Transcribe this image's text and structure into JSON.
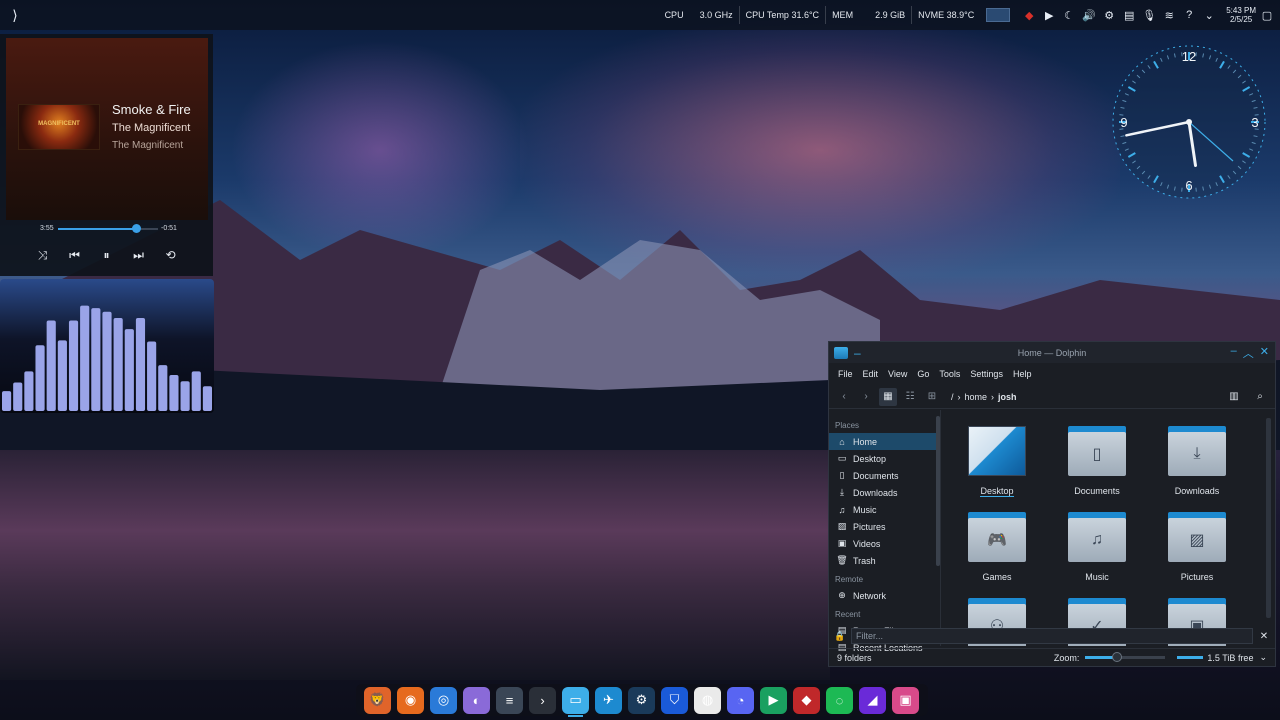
{
  "colors": {
    "accent": "#3daee9",
    "panel": "#0c121e",
    "window_bg": "#1b1e24",
    "selection": "#1d4a6a"
  },
  "top_panel": {
    "launcher_icon": "kde-launcher-icon",
    "sysmon": {
      "cpu_label": "CPU",
      "cpu_freq": "3.0 GHz",
      "cpu_temp": "CPU Temp  31.6°C",
      "mem_label": "MEM",
      "mem_value": "2.9 GiB",
      "nvme": "NVME  38.9°C"
    },
    "tray_icons": [
      "network-graph",
      "ruby-icon",
      "play-icon",
      "moon-icon",
      "volume-icon",
      "steam-icon",
      "clipboard-icon",
      "microphone-icon",
      "wifi-icon",
      "help-icon",
      "chevron-up-icon"
    ],
    "clock": {
      "time": "5:43 PM",
      "date": "2/5/25"
    }
  },
  "media_player": {
    "title": "Smoke & Fire",
    "album": "The Magnificent",
    "artist": "The Magnificent",
    "cover_text": "MAGNIFICENT",
    "elapsed": "3:55",
    "remaining": "-0:51",
    "progress": 0.78,
    "controls": [
      "shuffle",
      "previous",
      "pause",
      "next",
      "repeat"
    ]
  },
  "visualizer": {
    "bars": [
      0.16,
      0.23,
      0.32,
      0.53,
      0.73,
      0.57,
      0.73,
      0.85,
      0.83,
      0.8,
      0.75,
      0.66,
      0.75,
      0.56,
      0.37,
      0.29,
      0.24,
      0.32,
      0.2
    ]
  },
  "analog_clock": {
    "numbers": [
      "12",
      "3",
      "6",
      "9"
    ],
    "time": {
      "hour": 5,
      "minute": 43
    }
  },
  "dolphin": {
    "title": "Home — Dolphin",
    "menu": [
      "File",
      "Edit",
      "View",
      "Go",
      "Tools",
      "Settings",
      "Help"
    ],
    "breadcrumb": [
      "/",
      "home",
      "josh"
    ],
    "places_heading": "Places",
    "places": [
      {
        "label": "Home",
        "icon": "home-icon",
        "selected": true
      },
      {
        "label": "Desktop",
        "icon": "desktop-icon"
      },
      {
        "label": "Documents",
        "icon": "document-icon"
      },
      {
        "label": "Downloads",
        "icon": "download-icon"
      },
      {
        "label": "Music",
        "icon": "music-icon"
      },
      {
        "label": "Pictures",
        "icon": "image-icon"
      },
      {
        "label": "Videos",
        "icon": "video-icon"
      },
      {
        "label": "Trash",
        "icon": "trash-icon"
      }
    ],
    "remote_heading": "Remote",
    "remote": [
      {
        "label": "Network",
        "icon": "network-icon"
      }
    ],
    "recent_heading": "Recent",
    "recent": [
      {
        "label": "Recent Files",
        "icon": "recent-files-icon"
      },
      {
        "label": "Recent Locations",
        "icon": "recent-locations-icon"
      }
    ],
    "folders": [
      {
        "label": "Desktop",
        "icon": "desktop-thumbnail"
      },
      {
        "label": "Documents",
        "icon": "document-icon"
      },
      {
        "label": "Downloads",
        "icon": "download-icon"
      },
      {
        "label": "Games",
        "icon": "gamepad-icon"
      },
      {
        "label": "Music",
        "icon": "music-icon"
      },
      {
        "label": "Pictures",
        "icon": "image-icon"
      },
      {
        "label": "",
        "icon": "people-icon"
      },
      {
        "label": "",
        "icon": "check-icon"
      },
      {
        "label": "",
        "icon": "video-icon"
      }
    ],
    "filter_placeholder": "Filter...",
    "status_count": "9 folders",
    "zoom_label": "Zoom:",
    "zoom_level": 0.4,
    "free_space": "1.5 TiB free"
  },
  "dock": {
    "items": [
      {
        "name": "brave-icon",
        "bg": "#e0642a",
        "glyph": "🦁"
      },
      {
        "name": "firefox-icon",
        "bg": "#e66a1e",
        "glyph": "◉"
      },
      {
        "name": "chromium-icon",
        "bg": "#2a7ad8",
        "glyph": "◎"
      },
      {
        "name": "color-picker-icon",
        "bg": "#8a6ad8",
        "glyph": "◐"
      },
      {
        "name": "system-settings-icon",
        "bg": "#3a4656",
        "glyph": "≡"
      },
      {
        "name": "konsole-icon",
        "bg": "#2a2f38",
        "glyph": "›"
      },
      {
        "name": "dolphin-icon",
        "bg": "#3daee9",
        "glyph": "▭"
      },
      {
        "name": "bottles-icon",
        "bg": "#1d8ad0",
        "glyph": "✈"
      },
      {
        "name": "steam-icon",
        "bg": "#1a3a5a",
        "glyph": "⚙"
      },
      {
        "name": "bitwarden-icon",
        "bg": "#1a5ad8",
        "glyph": "⛉"
      },
      {
        "name": "lutris-icon",
        "bg": "#eaeaea",
        "glyph": "◍"
      },
      {
        "name": "discord-icon",
        "bg": "#5865f2",
        "glyph": "◔"
      },
      {
        "name": "play-store-icon",
        "bg": "#1aa060",
        "glyph": "▶"
      },
      {
        "name": "ruby-app-icon",
        "bg": "#c0282a",
        "glyph": "◆"
      },
      {
        "name": "spotify-icon",
        "bg": "#1db954",
        "glyph": "◌"
      },
      {
        "name": "heroic-icon",
        "bg": "#6a2ad8",
        "glyph": "◢"
      },
      {
        "name": "virt-manager-icon",
        "bg": "#d84a8a",
        "glyph": "▣"
      }
    ]
  }
}
